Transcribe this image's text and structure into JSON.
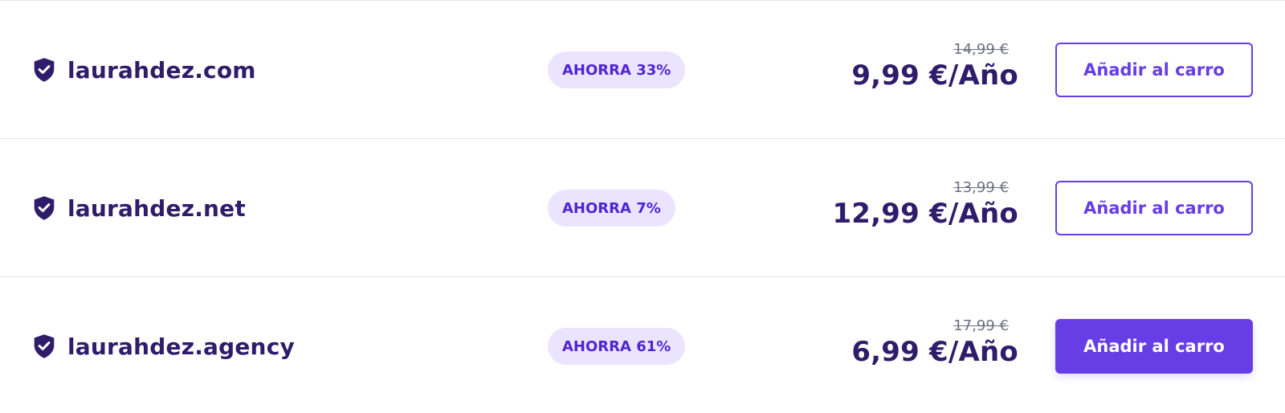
{
  "colors": {
    "accent": "#673de6",
    "text_dark": "#2f1c6a",
    "badge_bg": "#ebe4ff",
    "badge_text": "#5025d1",
    "muted": "#6d7081"
  },
  "rows": [
    {
      "icon": "shield-check-icon",
      "domain": "laurahdez.com",
      "badge": "AHORRA 33%",
      "old_price": "14,99 €",
      "new_price": "9,99 €/Año",
      "button": "Añadir al carro",
      "button_style": "outline"
    },
    {
      "icon": "shield-check-icon",
      "domain": "laurahdez.net",
      "badge": "AHORRA 7%",
      "old_price": "13,99 €",
      "new_price": "12,99 €/Año",
      "button": "Añadir al carro",
      "button_style": "outline"
    },
    {
      "icon": "shield-check-icon",
      "domain": "laurahdez.agency",
      "badge": "AHORRA 61%",
      "old_price": "17,99 €",
      "new_price": "6,99 €/Año",
      "button": "Añadir al carro",
      "button_style": "filled"
    }
  ]
}
